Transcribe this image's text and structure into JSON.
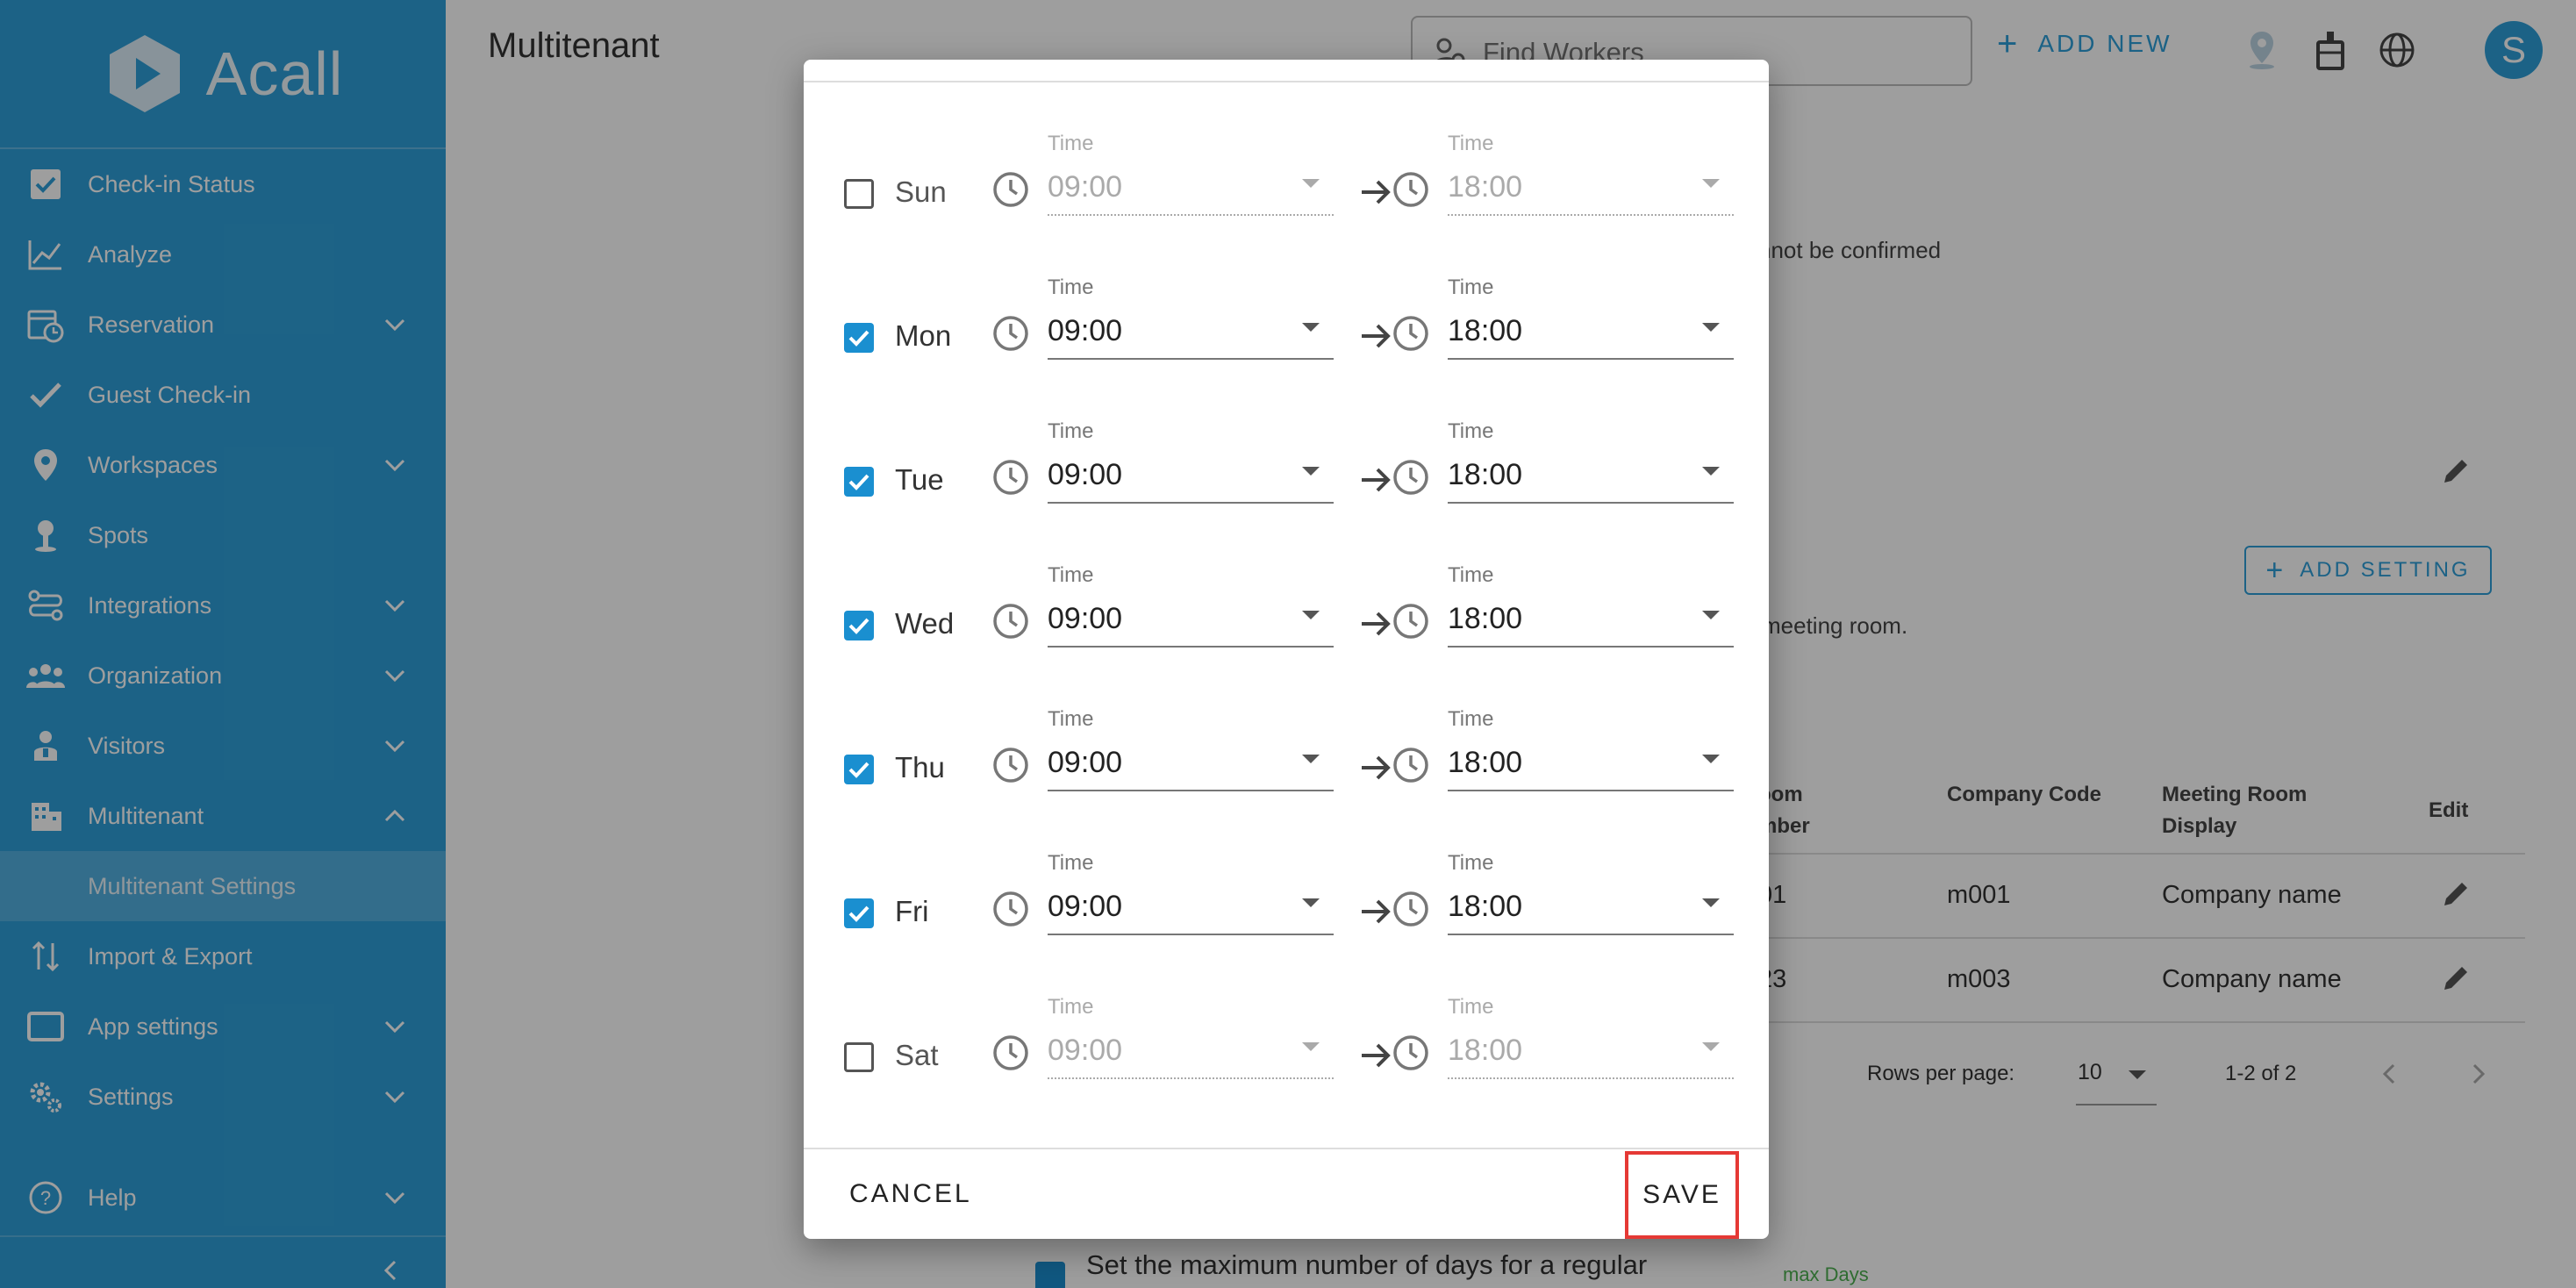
{
  "app": {
    "logo_text": "Acall",
    "page_title": "Multitenant"
  },
  "colors": {
    "accent": "#2e9fd9",
    "highlight": "#e53935"
  },
  "sidebar": {
    "items": [
      {
        "label": "Check-in Status",
        "icon": "checkbox-icon"
      },
      {
        "label": "Analyze",
        "icon": "line-chart-icon"
      },
      {
        "label": "Reservation",
        "icon": "calendar-clock-icon"
      },
      {
        "label": "Guest Check-in",
        "icon": "check-icon"
      },
      {
        "label": "Workspaces",
        "icon": "map-pin-icon"
      },
      {
        "label": "Spots",
        "icon": "person-pin-icon"
      },
      {
        "label": "Integrations",
        "icon": "integration-icon"
      },
      {
        "label": "Organization",
        "icon": "people-icon"
      },
      {
        "label": "Visitors",
        "icon": "visitor-icon"
      },
      {
        "label": "Multitenant",
        "icon": "building-icon"
      },
      {
        "label": "Multitenant Settings",
        "icon": ""
      },
      {
        "label": "Import & Export",
        "icon": "import-export-icon"
      },
      {
        "label": "App settings",
        "icon": "tablet-icon"
      },
      {
        "label": "Settings",
        "icon": "gear-icon"
      },
      {
        "label": "Help",
        "icon": "help-icon"
      }
    ]
  },
  "header": {
    "search_placeholder": "Find Workers",
    "add_new_label": "ADD NEW",
    "avatar_initial": "S"
  },
  "background": {
    "confirm_text": "nnot be confirmed",
    "add_setting_label": "ADD SETTING",
    "meeting_room_text": "meeting room.",
    "table": {
      "headers": [
        "oom\nmber",
        "Company Code",
        "Meeting Room\nDisplay",
        "Edit"
      ],
      "rows": [
        [
          "01",
          "m001",
          "Company name"
        ],
        [
          "23",
          "m003",
          "Company name"
        ]
      ]
    },
    "rows_per_page_label": "Rows per page:",
    "rows_per_page_value": "10",
    "pagination_text": "1-2 of 2",
    "max_days_text": "Set the maximum number of days for a regular",
    "max_days_label": "max Days"
  },
  "dialog": {
    "days": [
      {
        "day": "Sun",
        "checked": false,
        "start_label": "Time",
        "start": "09:00",
        "end_label": "Time",
        "end": "18:00"
      },
      {
        "day": "Mon",
        "checked": true,
        "start_label": "Time",
        "start": "09:00",
        "end_label": "Time",
        "end": "18:00"
      },
      {
        "day": "Tue",
        "checked": true,
        "start_label": "Time",
        "start": "09:00",
        "end_label": "Time",
        "end": "18:00"
      },
      {
        "day": "Wed",
        "checked": true,
        "start_label": "Time",
        "start": "09:00",
        "end_label": "Time",
        "end": "18:00"
      },
      {
        "day": "Thu",
        "checked": true,
        "start_label": "Time",
        "start": "09:00",
        "end_label": "Time",
        "end": "18:00"
      },
      {
        "day": "Fri",
        "checked": true,
        "start_label": "Time",
        "start": "09:00",
        "end_label": "Time",
        "end": "18:00"
      },
      {
        "day": "Sat",
        "checked": false,
        "start_label": "Time",
        "start": "09:00",
        "end_label": "Time",
        "end": "18:00"
      }
    ],
    "cancel_label": "CANCEL",
    "save_label": "SAVE"
  }
}
